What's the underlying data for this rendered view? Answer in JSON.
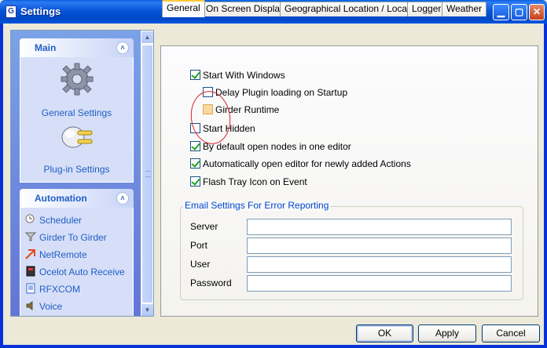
{
  "window": {
    "title": "Settings",
    "icon_letter": "G",
    "minimize_icon": "minimize-icon",
    "maximize_icon": "maximize-icon",
    "close_icon": "close-icon"
  },
  "sidebar": {
    "groups": [
      {
        "title": "Main",
        "items": [
          {
            "label": "General Settings",
            "icon": "gear-icon"
          },
          {
            "label": "Plug-in Settings",
            "icon": "plug-icon"
          }
        ]
      },
      {
        "title": "Automation",
        "items": [
          {
            "label": "Scheduler",
            "icon": "scheduler-icon"
          },
          {
            "label": "Girder To Girder",
            "icon": "girder-to-girder-icon"
          },
          {
            "label": "NetRemote",
            "icon": "netremote-icon"
          },
          {
            "label": "Ocelot Auto Receive",
            "icon": "ocelot-icon"
          },
          {
            "label": "RFXCOM",
            "icon": "rfxcom-icon"
          },
          {
            "label": "Voice",
            "icon": "voice-icon"
          }
        ]
      }
    ]
  },
  "tabs": [
    {
      "label": "General",
      "active": true
    },
    {
      "label": "On Screen Display",
      "active": false
    },
    {
      "label": "Geographical Location / Locale",
      "active": false
    },
    {
      "label": "Logger",
      "active": false
    },
    {
      "label": "Weather",
      "active": false
    }
  ],
  "general": {
    "options": [
      {
        "label": "Start With Windows",
        "checked": true
      },
      {
        "label": "Delay Plugin loading on Startup",
        "checked": false
      },
      {
        "label": "Girder Runtime",
        "checked": false
      },
      {
        "label": "Start Hidden",
        "checked": false
      },
      {
        "label": "By default open nodes in one editor",
        "checked": true
      },
      {
        "label": "Automatically open editor for newly added Actions",
        "checked": true
      },
      {
        "label": "Flash Tray Icon on Event",
        "checked": true
      }
    ],
    "email": {
      "legend": "Email Settings For Error Reporting",
      "fields": [
        {
          "label": "Server",
          "value": ""
        },
        {
          "label": "Port",
          "value": ""
        },
        {
          "label": "User",
          "value": ""
        },
        {
          "label": "Password",
          "value": ""
        }
      ]
    }
  },
  "buttons": {
    "ok": "OK",
    "apply": "Apply",
    "cancel": "Cancel"
  },
  "colors": {
    "titlebar": "#0054E3",
    "sidebar_link": "#215DC6",
    "legend": "#0046D5",
    "annotation": "#D8232A"
  }
}
